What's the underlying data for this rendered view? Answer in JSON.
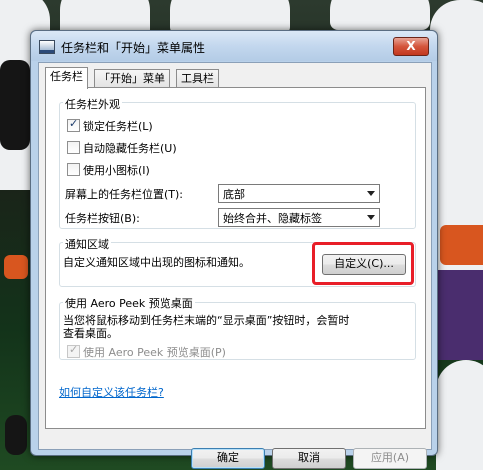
{
  "window": {
    "title": "任务栏和「开始」菜单属性",
    "close_label": "X"
  },
  "tabs": [
    {
      "label": "任务栏"
    },
    {
      "label": "「开始」菜单"
    },
    {
      "label": "工具栏"
    }
  ],
  "appearance": {
    "title": "任务栏外观",
    "lock_taskbar": {
      "label": "锁定任务栏(L)",
      "checked": true
    },
    "auto_hide": {
      "label": "自动隐藏任务栏(U)",
      "checked": false
    },
    "small_icons": {
      "label": "使用小图标(I)",
      "checked": false
    },
    "location_label": "屏幕上的任务栏位置(T):",
    "location_value": "底部",
    "buttons_label": "任务栏按钮(B):",
    "buttons_value": "始终合并、隐藏标签"
  },
  "notification": {
    "title": "通知区域",
    "description": "自定义通知区域中出现的图标和通知。",
    "customize_button": "自定义(C)..."
  },
  "aero_peek": {
    "title": "使用 Aero Peek 预览桌面",
    "description_line1": "当您将鼠标移动到任务栏末端的“显示桌面”按钮时，会暂时",
    "description_line2": "查看桌面。",
    "checkbox_label": "使用 Aero Peek 预览桌面(P)",
    "checked": true,
    "disabled": true
  },
  "help_link": "如何自定义该任务栏?",
  "footer": {
    "ok": "确定",
    "cancel": "取消",
    "apply": "应用(A)"
  },
  "colors": {
    "highlight": "#e81e28",
    "link": "#0066cc",
    "titlebar": "#c3d7ee"
  }
}
